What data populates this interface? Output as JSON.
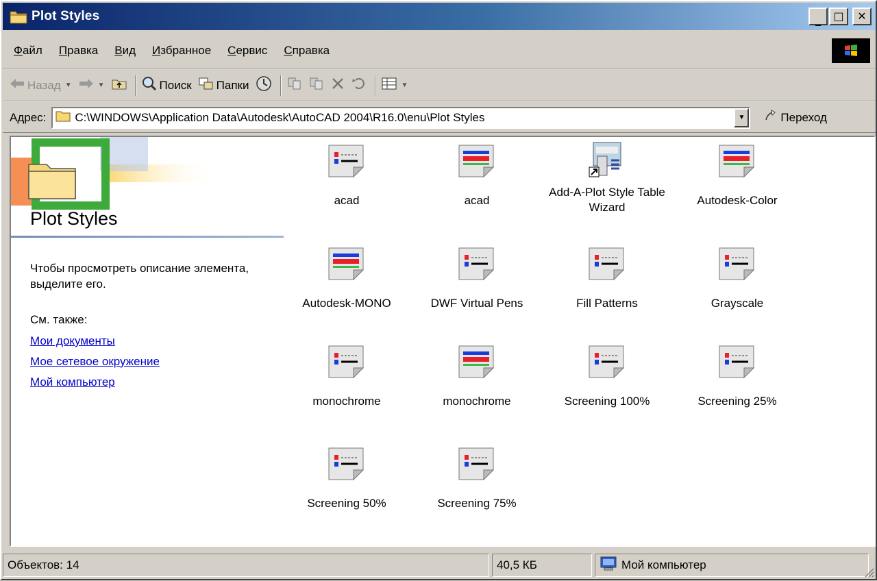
{
  "window": {
    "title": "Plot Styles"
  },
  "menu": [
    {
      "ul": "Ф",
      "rest": "айл"
    },
    {
      "ul": "П",
      "rest": "равка"
    },
    {
      "ul": "В",
      "rest": "ид"
    },
    {
      "ul": "И",
      "rest": "збранное"
    },
    {
      "ul": "С",
      "rest": "ервис"
    },
    {
      "ul": "С",
      "rest": "правка"
    }
  ],
  "toolbar": {
    "back": "Назад",
    "search": "Поиск",
    "folders": "Папки"
  },
  "address": {
    "label": "Адрес:",
    "path": "C:\\WINDOWS\\Application Data\\Autodesk\\AutoCAD 2004\\R16.0\\enu\\Plot Styles",
    "go": "Переход"
  },
  "left_pane": {
    "title": "Plot Styles",
    "description": "Чтобы просмотреть описание элемента, выделите его.",
    "see_also": "См. также:",
    "links": [
      "Мои документы",
      "Мое сетевое окружение",
      "Мой компьютер"
    ]
  },
  "files": [
    {
      "name": "acad",
      "icon": "ctb-icon",
      "selected": true
    },
    {
      "name": "acad",
      "icon": "stb-icon"
    },
    {
      "name": "Add-A-Plot Style Table Wizard",
      "icon": "wizard-shortcut-icon"
    },
    {
      "name": "Autodesk-Color",
      "icon": "stb-icon"
    },
    {
      "name": "Autodesk-MONO",
      "icon": "stb-icon"
    },
    {
      "name": "DWF Virtual Pens",
      "icon": "ctb-icon"
    },
    {
      "name": "Fill Patterns",
      "icon": "ctb-icon"
    },
    {
      "name": "Grayscale",
      "icon": "ctb-icon"
    },
    {
      "name": "monochrome",
      "icon": "ctb-icon"
    },
    {
      "name": "monochrome",
      "icon": "stb-icon"
    },
    {
      "name": "Screening 100%",
      "icon": "ctb-icon"
    },
    {
      "name": "Screening 25%",
      "icon": "ctb-icon"
    },
    {
      "name": "Screening 50%",
      "icon": "ctb-icon"
    },
    {
      "name": "Screening 75%",
      "icon": "ctb-icon"
    }
  ],
  "status": {
    "objects": "Объектов: 14",
    "size": "40,5 КБ",
    "location": "Мой компьютер"
  },
  "colors": {
    "title_start": "#0a246a",
    "title_end": "#a6caf0",
    "face": "#d4d0c8",
    "link": "#0000cc"
  }
}
